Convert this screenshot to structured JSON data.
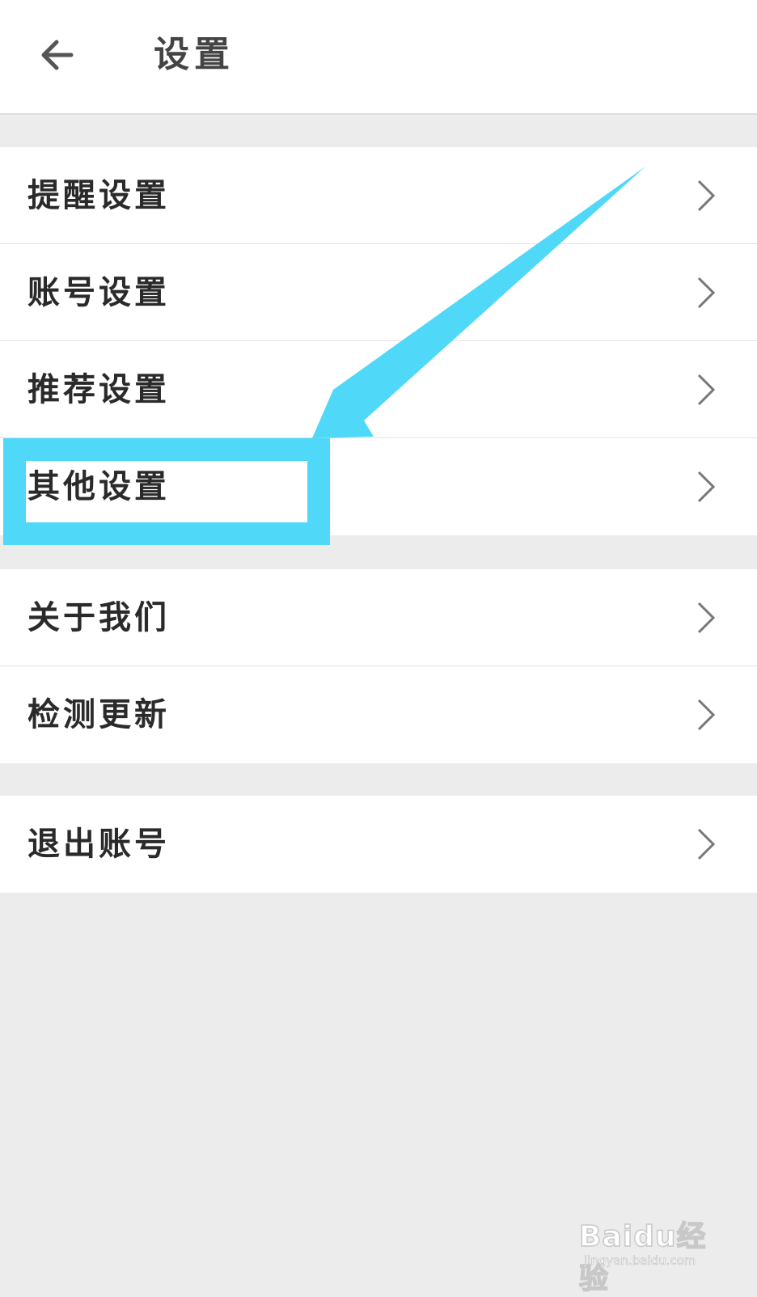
{
  "header": {
    "title": "设置",
    "back_icon": "arrow-left-icon"
  },
  "groups": [
    {
      "items": [
        {
          "label": "提醒设置"
        },
        {
          "label": "账号设置"
        },
        {
          "label": "推荐设置"
        },
        {
          "label": "其他设置",
          "highlighted": true
        }
      ]
    },
    {
      "items": [
        {
          "label": "关于我们"
        },
        {
          "label": "检测更新"
        }
      ]
    },
    {
      "items": [
        {
          "label": "退出账号"
        }
      ]
    }
  ],
  "annotation": {
    "color": "#4fd8f8",
    "target": "其他设置"
  },
  "watermark": {
    "logo": "Baidu经验",
    "url": "jingyan.baidu.com"
  },
  "colors": {
    "background": "#ececec",
    "card": "#ffffff",
    "accent": "#4fd8f8",
    "text": "#2a2a2a"
  }
}
